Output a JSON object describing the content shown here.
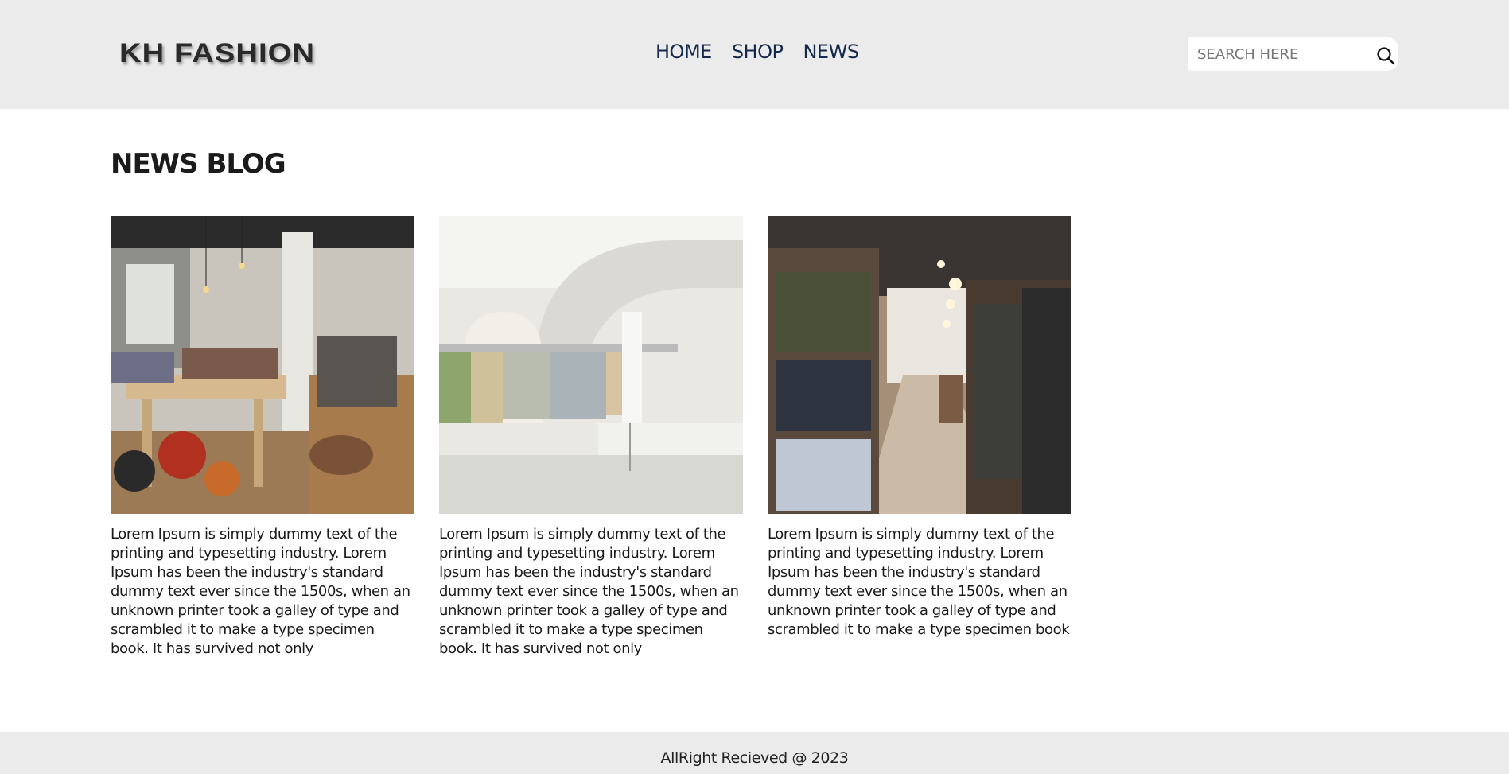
{
  "header": {
    "logo": "KH FASHION",
    "nav": [
      {
        "label": "HOME"
      },
      {
        "label": "SHOP"
      },
      {
        "label": "NEWS"
      }
    ],
    "search": {
      "placeholder": "SEARCH HERE",
      "value": "",
      "icon": "search-icon"
    }
  },
  "main": {
    "title": "NEWS BLOG",
    "cards": [
      {
        "image": "boutique-interior-photo",
        "text": "Lorem Ipsum is simply dummy text of the printing and typesetting industry. Lorem Ipsum has been the industry's standard dummy text ever since the 1500s, when an unknown printer took a galley of type and scrambled it to make a type specimen book. It has survived not only"
      },
      {
        "image": "white-store-interior-photo",
        "text": "Lorem Ipsum is simply dummy text of the printing and typesetting industry. Lorem Ipsum has been the industry's standard dummy text ever since the 1500s, when an unknown printer took a galley of type and scrambled it to make a type specimen book. It has survived not only"
      },
      {
        "image": "menswear-store-interior-photo",
        "text": "Lorem Ipsum is simply dummy text of the printing and typesetting industry. Lorem Ipsum has been the industry's standard dummy text ever since the 1500s, when an unknown printer took a galley of type and scrambled it to make a type specimen book"
      }
    ]
  },
  "footer": {
    "text": "AllRight Recieved @ 2023"
  },
  "colors": {
    "header_bg": "#ebebeb",
    "nav_text": "#15294a",
    "footer_bg": "#ebebeb"
  }
}
